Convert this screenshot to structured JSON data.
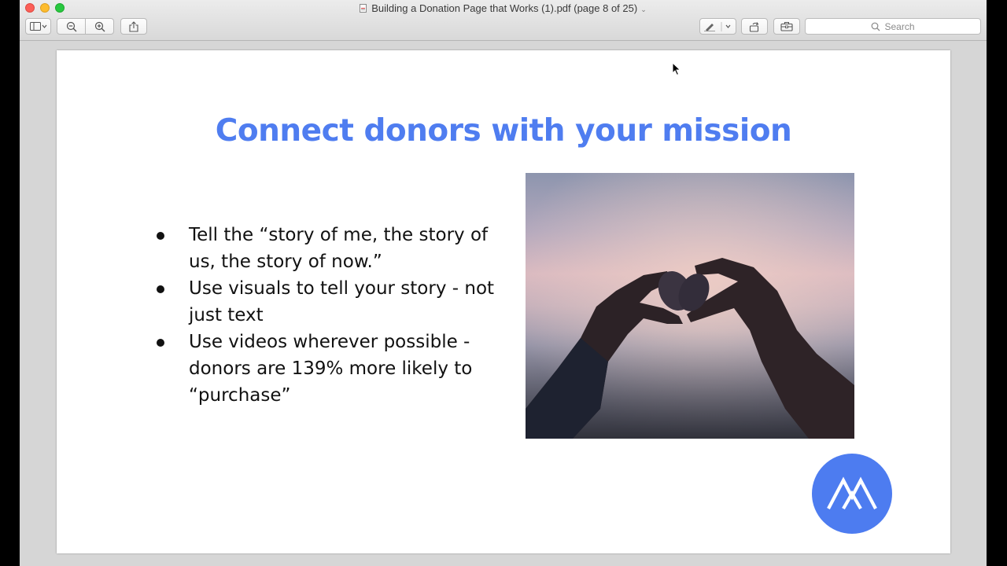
{
  "window": {
    "title": "Building a Donation Page that Works (1).pdf (page 8 of 25)"
  },
  "toolbar": {
    "search_label": "Search",
    "icons": [
      "sidebar-icon",
      "zoom-out-icon",
      "zoom-in-icon",
      "share-icon",
      "markup-pen-icon",
      "rotate-icon",
      "toolbox-icon",
      "search-icon"
    ]
  },
  "slide": {
    "title": "Connect donors with your mission",
    "bullets": [
      "Tell the “story of me, the story of us, the story of now.”",
      "Use visuals to tell your story - not just text",
      "Use videos wherever possible - donors are 139% more likely to “purchase”"
    ],
    "image": "hands-heart-shells-photo",
    "logo": "m-logo-icon"
  },
  "colors": {
    "title_blue": "#4f7df0",
    "logo_blue": "#4d7cf0"
  }
}
